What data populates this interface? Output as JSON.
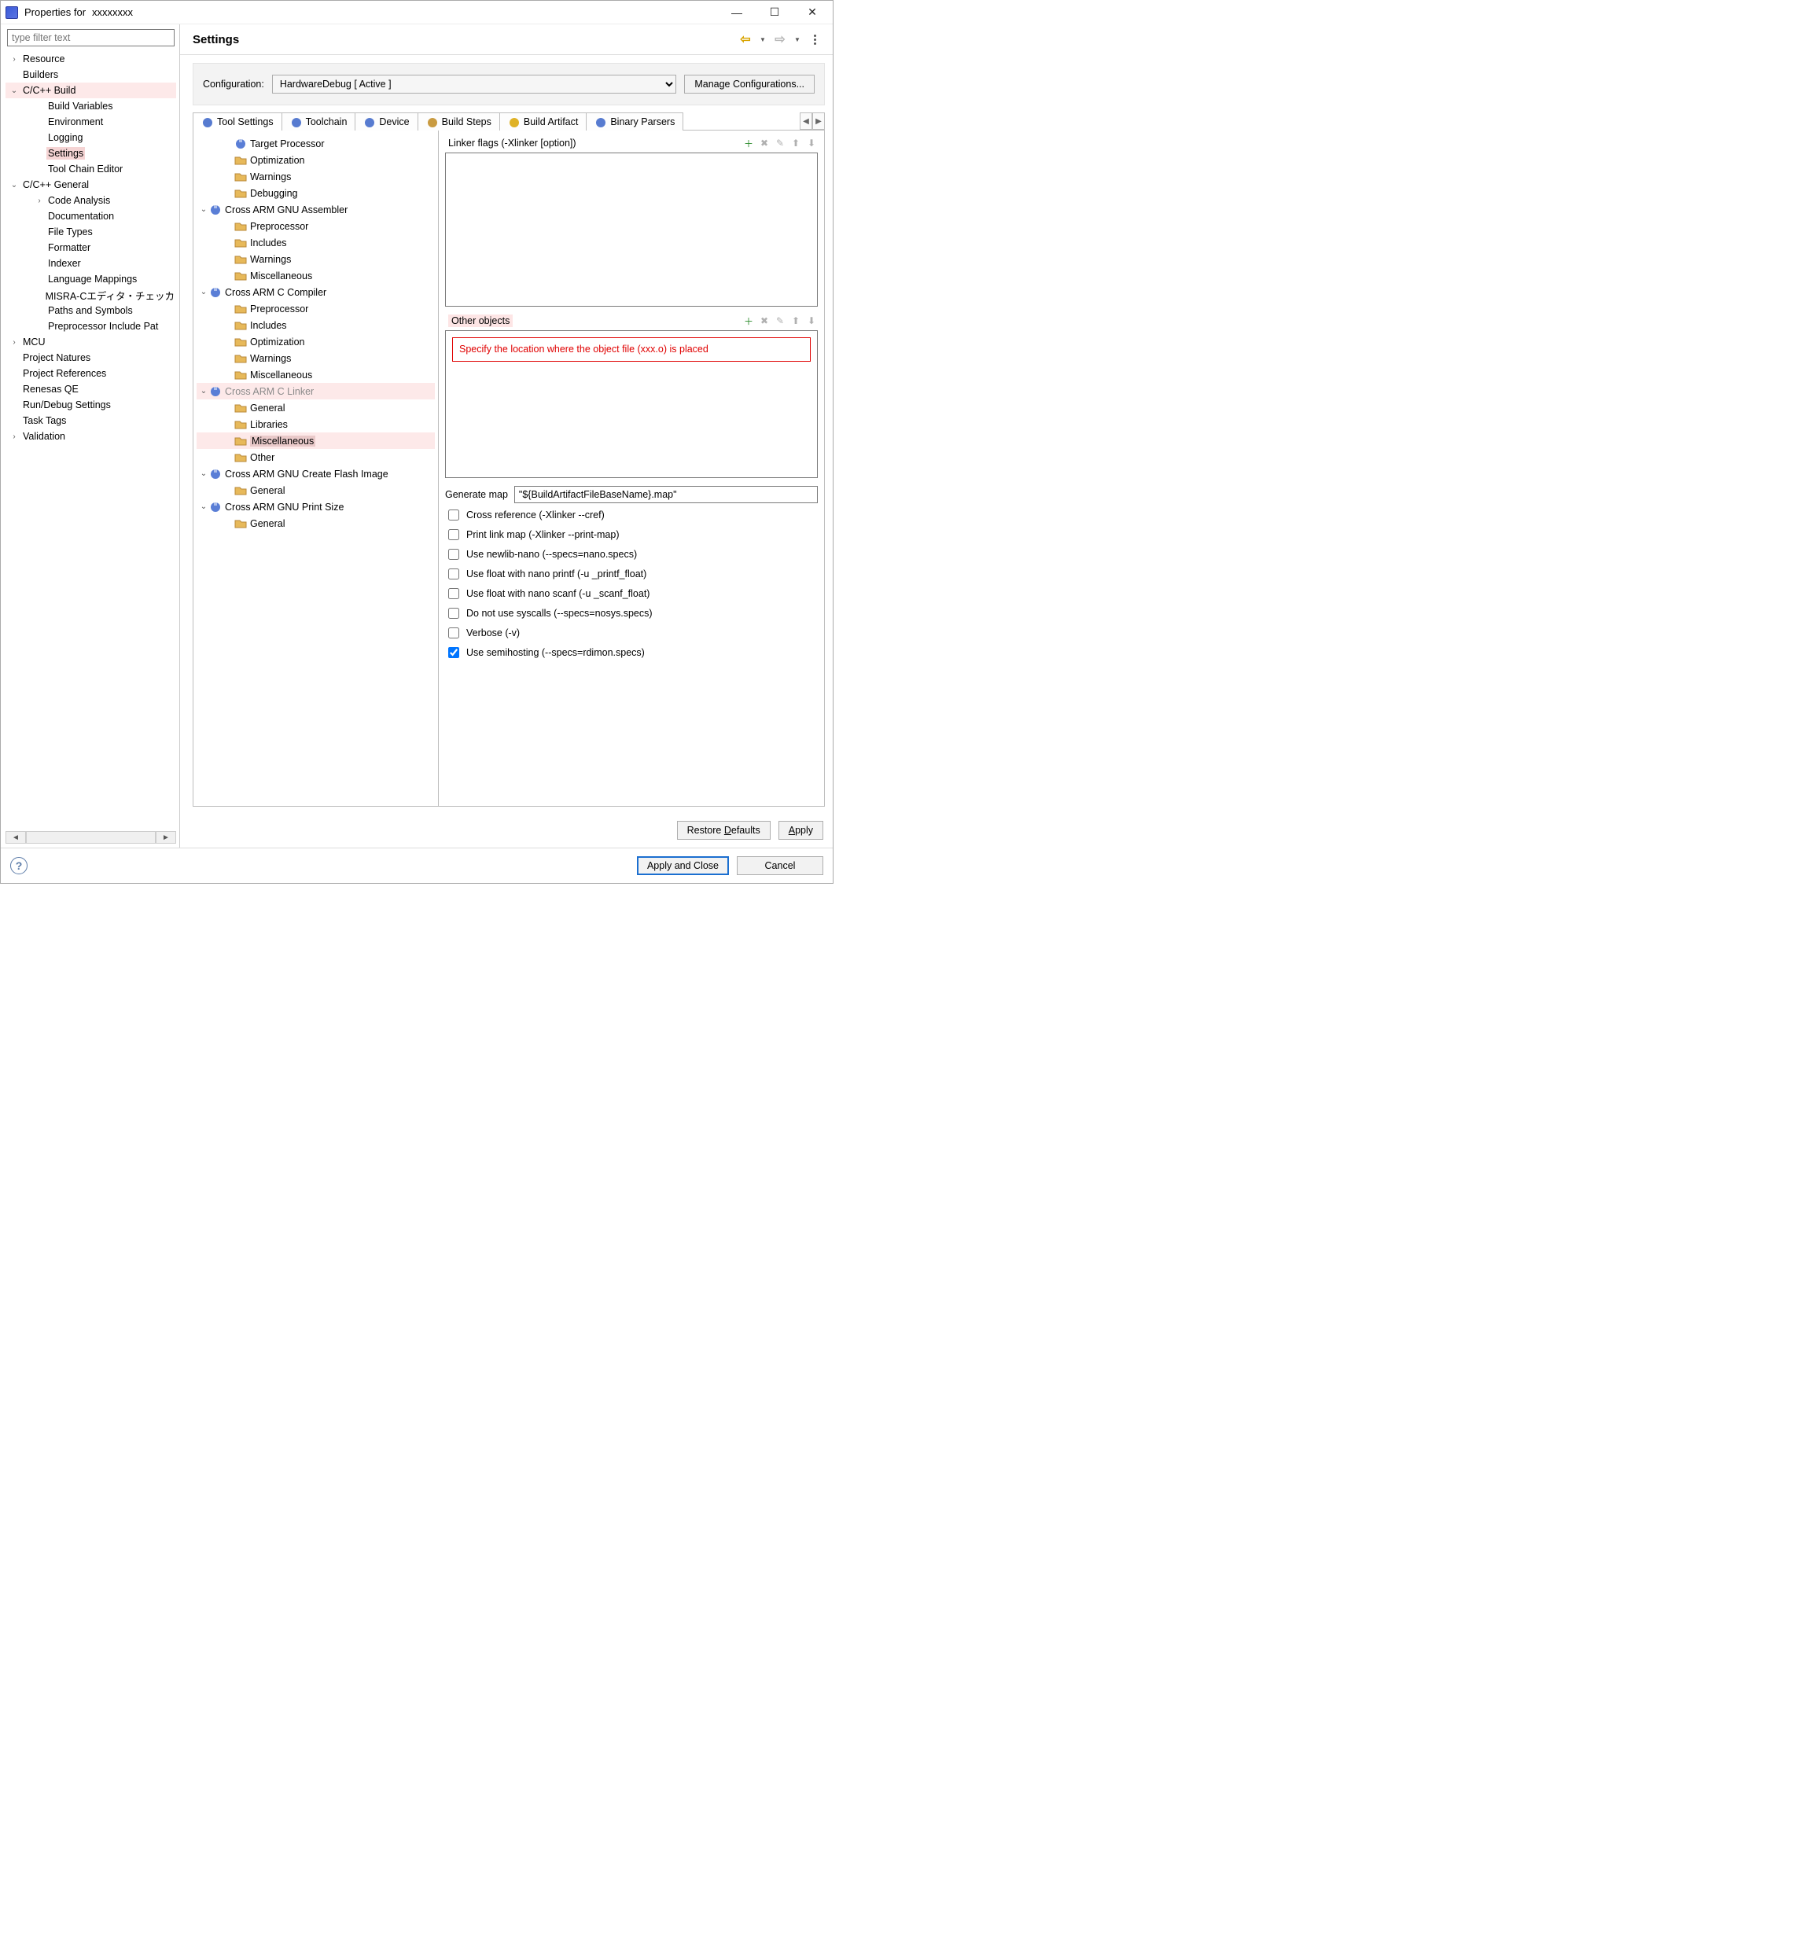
{
  "window": {
    "title_prefix": "Properties for",
    "project_name": "xxxxxxxx"
  },
  "left": {
    "filter_placeholder": "type filter text",
    "tree": [
      {
        "label": "Resource",
        "depth": 0,
        "arrow": ">"
      },
      {
        "label": "Builders",
        "depth": 0,
        "arrow": ""
      },
      {
        "label": "C/C++ Build",
        "depth": 0,
        "arrow": "v",
        "hl": true
      },
      {
        "label": "Build Variables",
        "depth": 1,
        "arrow": ""
      },
      {
        "label": "Environment",
        "depth": 1,
        "arrow": ""
      },
      {
        "label": "Logging",
        "depth": 1,
        "arrow": ""
      },
      {
        "label": "Settings",
        "depth": 1,
        "arrow": "",
        "sel": true
      },
      {
        "label": "Tool Chain Editor",
        "depth": 1,
        "arrow": ""
      },
      {
        "label": "C/C++ General",
        "depth": 0,
        "arrow": "v"
      },
      {
        "label": "Code Analysis",
        "depth": 1,
        "arrow": ">"
      },
      {
        "label": "Documentation",
        "depth": 1,
        "arrow": ""
      },
      {
        "label": "File Types",
        "depth": 1,
        "arrow": ""
      },
      {
        "label": "Formatter",
        "depth": 1,
        "arrow": ""
      },
      {
        "label": "Indexer",
        "depth": 1,
        "arrow": ""
      },
      {
        "label": "Language Mappings",
        "depth": 1,
        "arrow": ""
      },
      {
        "label": "MISRA-Cエディタ・チェッカ",
        "depth": 1,
        "arrow": ""
      },
      {
        "label": "Paths and Symbols",
        "depth": 1,
        "arrow": ""
      },
      {
        "label": "Preprocessor Include Pat",
        "depth": 1,
        "arrow": ""
      },
      {
        "label": "MCU",
        "depth": 0,
        "arrow": ">"
      },
      {
        "label": "Project Natures",
        "depth": 0,
        "arrow": ""
      },
      {
        "label": "Project References",
        "depth": 0,
        "arrow": ""
      },
      {
        "label": "Renesas QE",
        "depth": 0,
        "arrow": ""
      },
      {
        "label": "Run/Debug Settings",
        "depth": 0,
        "arrow": ""
      },
      {
        "label": "Task Tags",
        "depth": 0,
        "arrow": ""
      },
      {
        "label": "Validation",
        "depth": 0,
        "arrow": ">"
      }
    ]
  },
  "header": {
    "title": "Settings"
  },
  "config": {
    "label": "Configuration:",
    "selected": "HardwareDebug  [ Active ]",
    "manage_button": "Manage Configurations..."
  },
  "tabs": [
    "Tool Settings",
    "Toolchain",
    "Device",
    "Build Steps",
    "Build Artifact",
    "Binary Parsers"
  ],
  "active_tab": 0,
  "tool_tree": [
    {
      "label": "Target Processor",
      "depth": 2,
      "icon": "wrench"
    },
    {
      "label": "Optimization",
      "depth": 2,
      "icon": "folder"
    },
    {
      "label": "Warnings",
      "depth": 2,
      "icon": "folder"
    },
    {
      "label": "Debugging",
      "depth": 2,
      "icon": "folder"
    },
    {
      "label": "Cross ARM GNU Assembler",
      "depth": 1,
      "icon": "wrench",
      "arrow": "v"
    },
    {
      "label": "Preprocessor",
      "depth": 2,
      "icon": "folder"
    },
    {
      "label": "Includes",
      "depth": 2,
      "icon": "folder"
    },
    {
      "label": "Warnings",
      "depth": 2,
      "icon": "folder"
    },
    {
      "label": "Miscellaneous",
      "depth": 2,
      "icon": "folder"
    },
    {
      "label": "Cross ARM C Compiler",
      "depth": 1,
      "icon": "wrench",
      "arrow": "v"
    },
    {
      "label": "Preprocessor",
      "depth": 2,
      "icon": "folder"
    },
    {
      "label": "Includes",
      "depth": 2,
      "icon": "folder"
    },
    {
      "label": "Optimization",
      "depth": 2,
      "icon": "folder"
    },
    {
      "label": "Warnings",
      "depth": 2,
      "icon": "folder"
    },
    {
      "label": "Miscellaneous",
      "depth": 2,
      "icon": "folder"
    },
    {
      "label": "Cross ARM C Linker",
      "depth": 1,
      "icon": "wrench",
      "arrow": "v",
      "grey": true,
      "hl": true
    },
    {
      "label": "General",
      "depth": 2,
      "icon": "folder"
    },
    {
      "label": "Libraries",
      "depth": 2,
      "icon": "folder"
    },
    {
      "label": "Miscellaneous",
      "depth": 2,
      "icon": "folder",
      "sel": true
    },
    {
      "label": "Other",
      "depth": 2,
      "icon": "folder"
    },
    {
      "label": "Cross ARM GNU Create Flash Image",
      "depth": 1,
      "icon": "wrench",
      "arrow": "v"
    },
    {
      "label": "General",
      "depth": 2,
      "icon": "folder"
    },
    {
      "label": "Cross ARM GNU Print Size",
      "depth": 1,
      "icon": "wrench",
      "arrow": "v"
    },
    {
      "label": "General",
      "depth": 2,
      "icon": "folder"
    }
  ],
  "panel": {
    "linker_flags_header": "Linker flags (-Xlinker [option])",
    "other_objects_header": "Other objects",
    "callout": "Specify the location where the object file (xxx.o) is placed",
    "generate_map_label": "Generate map",
    "generate_map_value": "\"${BuildArtifactFileBaseName}.map\"",
    "checks": [
      {
        "label": "Cross reference (-Xlinker --cref)",
        "checked": false
      },
      {
        "label": "Print link map (-Xlinker --print-map)",
        "checked": false
      },
      {
        "label": "Use newlib-nano (--specs=nano.specs)",
        "checked": false
      },
      {
        "label": "Use float with nano printf (-u _printf_float)",
        "checked": false
      },
      {
        "label": "Use float with nano scanf (-u _scanf_float)",
        "checked": false
      },
      {
        "label": "Do not use syscalls (--specs=nosys.specs)",
        "checked": false
      },
      {
        "label": "Verbose (-v)",
        "checked": false
      },
      {
        "label": "Use semihosting (--specs=rdimon.specs)",
        "checked": true
      }
    ]
  },
  "buttons": {
    "restore_defaults": "Restore Defaults",
    "apply": "Apply",
    "apply_close": "Apply and Close",
    "cancel": "Cancel"
  }
}
